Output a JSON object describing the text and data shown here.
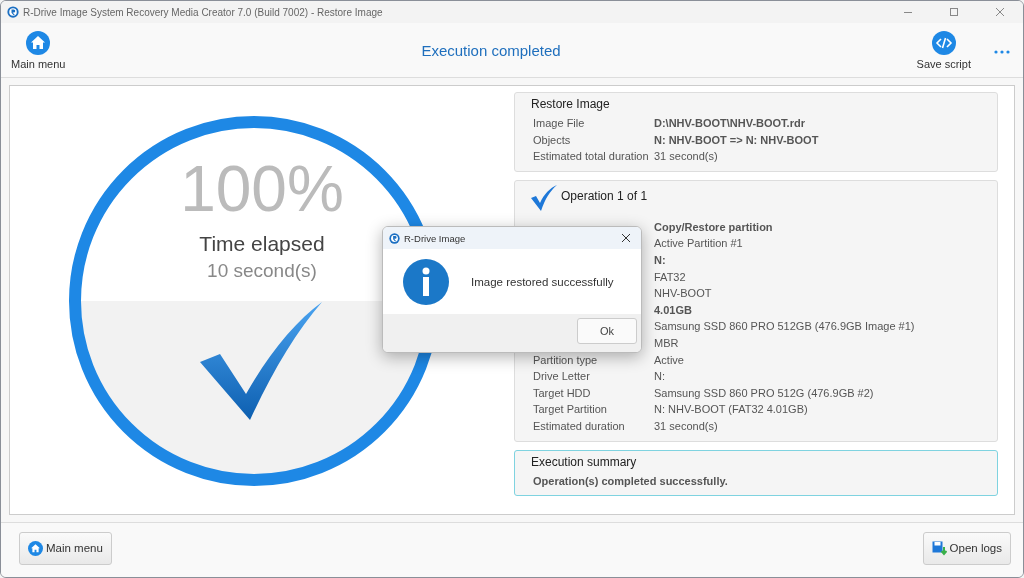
{
  "window": {
    "title": "R-Drive Image System Recovery Media Creator 7.0 (Build 7002) - Restore Image"
  },
  "toolbar": {
    "main_menu": "Main menu",
    "heading": "Execution completed",
    "save_script": "Save script"
  },
  "progress": {
    "percent": "100%",
    "label": "Time elapsed",
    "elapsed": "10 second(s)"
  },
  "restore_panel": {
    "title": "Restore Image",
    "rows": [
      {
        "label": "Image File",
        "value": "D:\\NHV-BOOT\\NHV-BOOT.rdr",
        "bold": true
      },
      {
        "label": "Objects",
        "value": "N: NHV-BOOT  => N: NHV-BOOT",
        "bold": true
      },
      {
        "label": "Estimated total duration",
        "value": "31 second(s)",
        "bold": false
      }
    ]
  },
  "operation_panel": {
    "title": "Operation 1 of 1",
    "rows": [
      {
        "value": "Copy/Restore partition",
        "bold": true
      },
      {
        "value": "Active Partition #1",
        "bold": false
      },
      {
        "value": "N:",
        "bold": true
      },
      {
        "value": "FAT32",
        "bold": false
      },
      {
        "value": "NHV-BOOT",
        "bold": false
      },
      {
        "value": "4.01GB",
        "bold": true
      },
      {
        "value": "Samsung SSD 860 PRO 512GB (476.9GB Image #1)",
        "bold": false
      },
      {
        "value": "MBR",
        "bold": false
      },
      {
        "label": "Partition type",
        "value": "Active",
        "bold": false
      },
      {
        "label": "Drive Letter",
        "value": "N:",
        "bold": false
      },
      {
        "label": "Target HDD",
        "value": "Samsung SSD 860 PRO 512G (476.9GB #2)",
        "bold": false
      },
      {
        "label": "Target Partition",
        "value": "N: NHV-BOOT (FAT32 4.01GB)",
        "bold": false
      },
      {
        "label": "Estimated duration",
        "value": "31 second(s)",
        "bold": false
      }
    ]
  },
  "summary_panel": {
    "title": "Execution summary",
    "message": "Operation(s) completed successfully."
  },
  "footer": {
    "main_menu": "Main menu",
    "open_logs": "Open logs"
  },
  "dialog": {
    "title": "R-Drive Image",
    "message": "Image restored successfully",
    "button": "Ok"
  }
}
